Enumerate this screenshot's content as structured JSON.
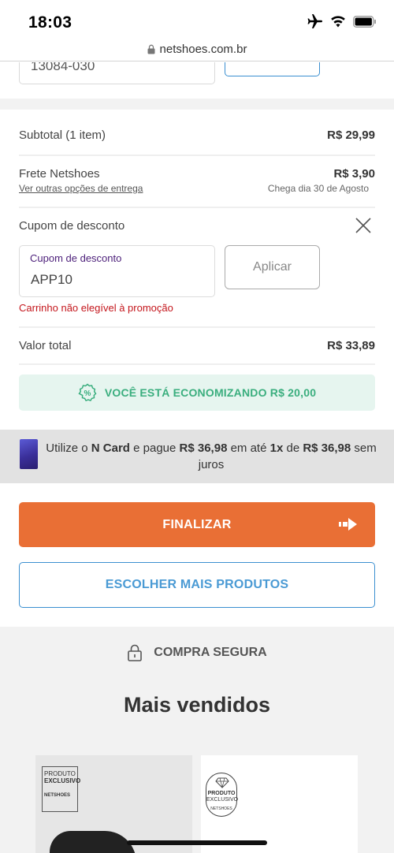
{
  "status_bar": {
    "time": "18:03"
  },
  "browser": {
    "url": "netshoes.com.br"
  },
  "shipping_calc": {
    "cep_value": "13084-030"
  },
  "summary": {
    "subtotal_label": "Subtotal (1 item)",
    "subtotal_value": "R$ 29,99",
    "shipping_label": "Frete Netshoes",
    "shipping_value": "R$ 3,90",
    "shipping_link": "Ver outras opções de entrega",
    "shipping_eta": "Chega dia 30 de Agosto",
    "coupon_title": "Cupom de desconto",
    "coupon_field_label": "Cupom de desconto",
    "coupon_field_value": "APP10",
    "apply_label": "Aplicar",
    "coupon_error": "Carrinho não elegível à promoção",
    "total_label": "Valor total",
    "total_value": "R$ 33,89",
    "savings_text": "VOCÊ ESTÁ ECONOMIZANDO R$ 20,00"
  },
  "ncard": {
    "t1": "Utilize o ",
    "t2": "N Card",
    "t3": " e pague ",
    "t4": "R$ 36,98",
    "t5": " em até ",
    "t6": "1x",
    "t7": " de ",
    "t8": "R$ 36,98",
    "t9": " sem juros"
  },
  "actions": {
    "finalize_label": "FINALIZAR",
    "more_products_label": "ESCOLHER MAIS PRODUTOS"
  },
  "footer": {
    "secure_label": "COMPRA SEGURA",
    "best_sellers_title": "Mais vendidos"
  },
  "products": [
    {
      "badge_line1": "PRODUTO",
      "badge_line2": "EXCLUSIVO",
      "badge_brand": "NETSHOES"
    },
    {
      "badge_line1": "PRODUTO",
      "badge_line2": "EXCLUSIVO",
      "badge_brand": "NETSHOES"
    }
  ],
  "colors": {
    "primary_orange": "#e96f35",
    "link_blue": "#4a9ad4",
    "savings_green": "#3aae7e",
    "error_red": "#c4161c",
    "coupon_purple": "#4b1e79"
  },
  "icons": [
    "airplane-icon",
    "wifi-icon",
    "battery-icon",
    "lock-icon",
    "close-icon",
    "discount-badge-icon",
    "card-icon",
    "arrow-right-icon",
    "padlock-icon",
    "diamond-icon"
  ]
}
